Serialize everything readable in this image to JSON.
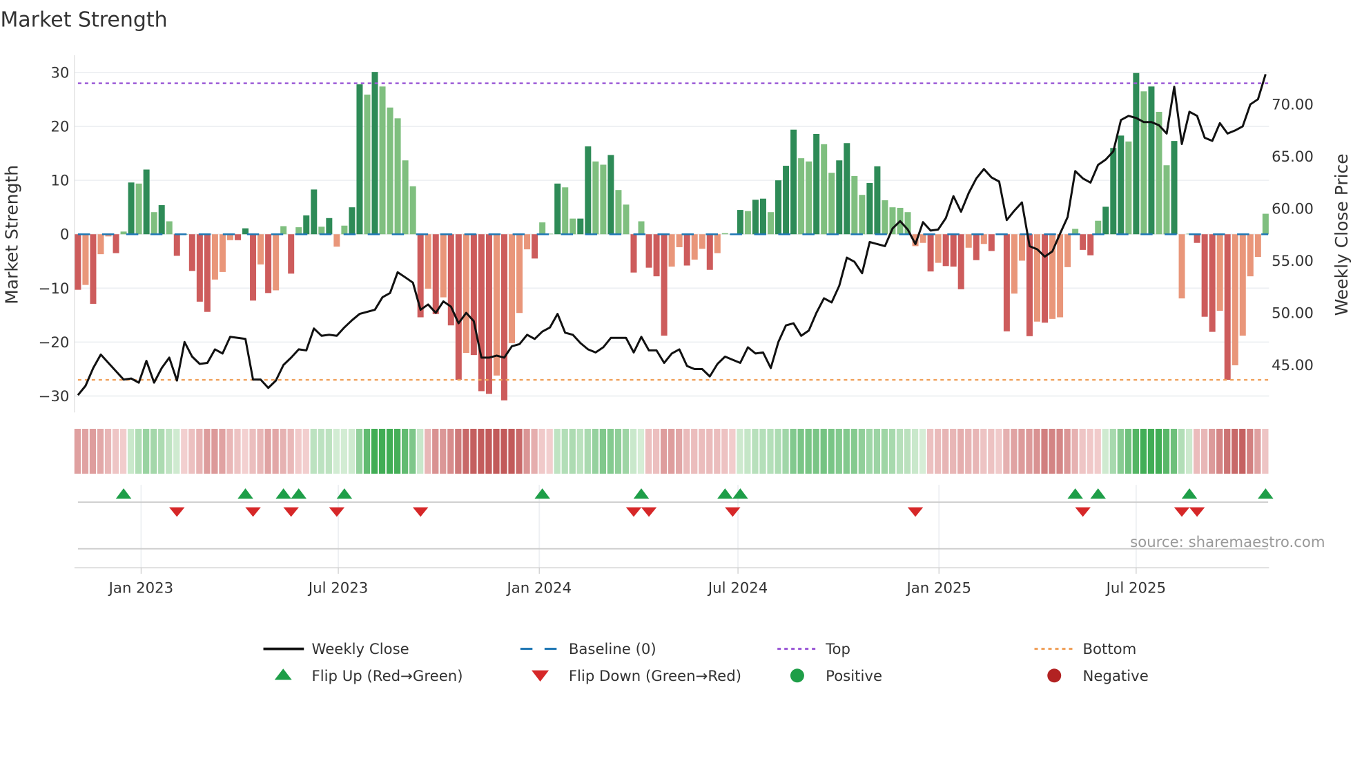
{
  "chart_data": {
    "type": "bar",
    "title": "Market Strength",
    "ylabel": "Market Strength",
    "y2label": "Weekly Close Price",
    "ylim": [
      -32,
      31
    ],
    "y2lim": [
      41.5,
      74
    ],
    "yticks": [
      30,
      20,
      10,
      0,
      -10,
      -20,
      -30
    ],
    "ytick_labels": [
      "30",
      "20",
      "10",
      "0",
      "−10",
      "−20",
      "−30"
    ],
    "y2ticks": [
      70,
      65,
      60,
      55,
      50,
      45
    ],
    "y2tick_labels": [
      "70.00",
      "65.00",
      "60.00",
      "55.00",
      "50.00",
      "45.00"
    ],
    "xticks": [
      {
        "label": "Jan 2023",
        "week": 8.3
      },
      {
        "label": "Jul 2023",
        "week": 34.2
      },
      {
        "label": "Jan 2024",
        "week": 60.6
      },
      {
        "label": "Jul 2024",
        "week": 86.7
      },
      {
        "label": "Jan 2025",
        "week": 113.1
      },
      {
        "label": "Jul 2025",
        "week": 139.0
      }
    ],
    "top_level": 28,
    "bottom_level": -27,
    "baseline": 0,
    "grid": true,
    "legend_position": "bottom",
    "strength": [
      -10.3,
      -9.4,
      -12.9,
      -3.7,
      -0.4,
      -3.5,
      0.5,
      9.6,
      9.4,
      12,
      4.1,
      5.4,
      2.4,
      -4,
      0,
      -6.8,
      -12.5,
      -14.4,
      -8.4,
      -7,
      -1.1,
      -1.1,
      1.1,
      -12.3,
      -5.6,
      -10.9,
      -10.4,
      1.5,
      -7.3,
      1.3,
      3.5,
      8.3,
      1.4,
      3,
      -2.3,
      1.6,
      5,
      27.8,
      25.9,
      30.1,
      27.4,
      23.5,
      21.5,
      13.7,
      8.9,
      -15.4,
      -10.1,
      -14.8,
      -11.7,
      -16.9,
      -27,
      -22,
      -22.4,
      -29.1,
      -29.6,
      -26.2,
      -30.8,
      -20.2,
      -14.6,
      -2.8,
      -4.5,
      2.2,
      0.1,
      9.4,
      8.7,
      2.9,
      2.9,
      16.3,
      13.5,
      12.9,
      14.7,
      8.2,
      5.5,
      -7.1,
      2.4,
      -6.2,
      -7.8,
      -18.8,
      -6,
      -2.4,
      -5.8,
      -4.7,
      -2.7,
      -6.6,
      -3.5,
      0.2,
      0,
      4.5,
      4.3,
      6.4,
      6.6,
      4.1,
      10,
      12.7,
      19.4,
      14.1,
      13.5,
      18.6,
      16.7,
      11.4,
      13.7,
      16.9,
      10.8,
      7.3,
      9.5,
      12.6,
      6.3,
      5,
      4.9,
      4.1,
      -2.2,
      -1.6,
      -6.9,
      -5.3,
      -5.9,
      -6,
      -10.2,
      -2.5,
      -4.8,
      -1.8,
      -3.1,
      0,
      -18,
      -11,
      -4.9,
      -18.9,
      -16.2,
      -16.4,
      -15.7,
      -15.4,
      -6.1,
      1,
      -2.9,
      -3.9,
      2.5,
      5.1,
      16,
      18.3,
      17.2,
      29.9,
      26.5,
      27.4,
      22.7,
      12.8,
      17.3,
      -11.9,
      0.1,
      -1.6,
      -15.3,
      -18.1,
      -14.2,
      -27,
      -24.3,
      -18.8,
      -7.8,
      -4.2,
      3.8
    ],
    "weekly_close": [
      42.1,
      43,
      44.7,
      46,
      45.2,
      44.4,
      43.6,
      43.7,
      43.3,
      45.4,
      43.3,
      44.7,
      45.7,
      43.5,
      47.2,
      45.8,
      45.1,
      45.2,
      46.5,
      46.1,
      47.7,
      47.6,
      47.5,
      43.6,
      43.6,
      42.8,
      43.5,
      45,
      45.7,
      46.5,
      46.4,
      48.5,
      47.8,
      47.9,
      47.8,
      48.6,
      49.3,
      49.9,
      50.1,
      50.3,
      51.5,
      51.9,
      53.9,
      53.4,
      52.9,
      50.3,
      50.8,
      50,
      51.1,
      50.6,
      49,
      50,
      49.2,
      45.7,
      45.7,
      45.9,
      45.7,
      46.8,
      47,
      47.9,
      47.5,
      48.2,
      48.6,
      49.9,
      48.1,
      47.9,
      47.1,
      46.5,
      46.2,
      46.7,
      47.6,
      47.6,
      47.6,
      46.2,
      47.7,
      46.4,
      46.4,
      45.2,
      46.1,
      46.5,
      44.9,
      44.6,
      44.6,
      43.9,
      45.1,
      45.8,
      45.5,
      45.2,
      46.7,
      46.1,
      46.2,
      44.7,
      47.2,
      48.8,
      49,
      47.8,
      48.3,
      50,
      51.4,
      51,
      52.6,
      55.3,
      54.9,
      53.8,
      56.8,
      56.6,
      56.4,
      58.1,
      58.8,
      58,
      56.6,
      58.7,
      57.9,
      58,
      59.1,
      61.2,
      59.7,
      61.5,
      62.9,
      63.8,
      63,
      62.6,
      58.9,
      59.8,
      60.6,
      56.4,
      56.1,
      55.4,
      55.9,
      57.6,
      59.2,
      63.6,
      62.9,
      62.5,
      64.2,
      64.7,
      65.5,
      68.5,
      68.9,
      68.7,
      68.3,
      68.3,
      68,
      67.2,
      71.7,
      66.2,
      69.3,
      68.9,
      66.8,
      66.5,
      68.2,
      67.2,
      67.5,
      67.9,
      70,
      70.5,
      72.9
    ],
    "flip_up_weeks": [
      6,
      22,
      27,
      29,
      35,
      61,
      74,
      85,
      87,
      131,
      134,
      146,
      156
    ],
    "flip_down_weeks": [
      13,
      23,
      28,
      34,
      45,
      73,
      75,
      86,
      110,
      132,
      145,
      147
    ],
    "legend": [
      {
        "label": "Weekly Close",
        "symbol": "line",
        "color": "#111111"
      },
      {
        "label": "Baseline (0)",
        "symbol": "dash",
        "color": "#1f77b4"
      },
      {
        "label": "Top",
        "symbol": "dot",
        "color": "#9b59d6"
      },
      {
        "label": "Bottom",
        "symbol": "dot",
        "color": "#f0a05a"
      },
      {
        "label": "Flip Up (Red→Green)",
        "symbol": "triangle-up",
        "color": "#1e9e48"
      },
      {
        "label": "Flip Down (Green→Red)",
        "symbol": "triangle-down",
        "color": "#d62728"
      },
      {
        "label": "Positive",
        "symbol": "circle",
        "color": "#1e9e48"
      },
      {
        "label": "Negative",
        "symbol": "circle",
        "color": "#b22222"
      }
    ]
  },
  "colors": {
    "pos_strong": "#2e8b57",
    "pos_weak": "#7fbf7f",
    "neg_strong": "#cd5c5c",
    "neg_weak": "#e9967a"
  },
  "source": "source: sharemaestro.com"
}
